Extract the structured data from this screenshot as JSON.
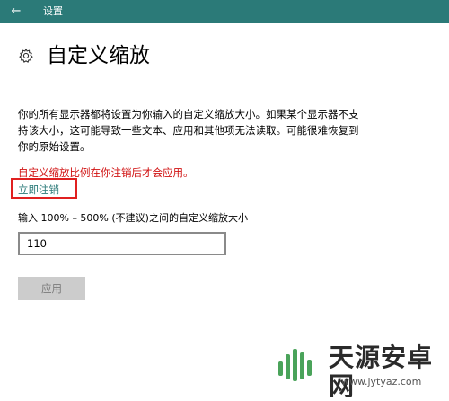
{
  "titlebar": {
    "back_icon": "back-arrow-icon",
    "back_glyph": "←",
    "title": "设置",
    "bg_color": "#2b7a78"
  },
  "header": {
    "icon": "gear-icon",
    "title": "自定义缩放"
  },
  "main": {
    "description": "你的所有显示器都将设置为你输入的自定义缩放大小。如果某个显示器不支持该大小，这可能导致一些文本、应用和其他项无法读取。可能很难恢复到你的原始设置。",
    "warning": "自定义缩放比例在你注销后才会应用。",
    "warning_color": "#d01010",
    "signout_link": "立即注销",
    "link_color": "#2b7a78",
    "input_label": "输入 100% – 500% (不建议)之间的自定义缩放大小",
    "input_value": "110",
    "apply_button": "应用"
  },
  "watermark": {
    "name": "天源安卓网",
    "url": "www.jytyaz.com"
  }
}
